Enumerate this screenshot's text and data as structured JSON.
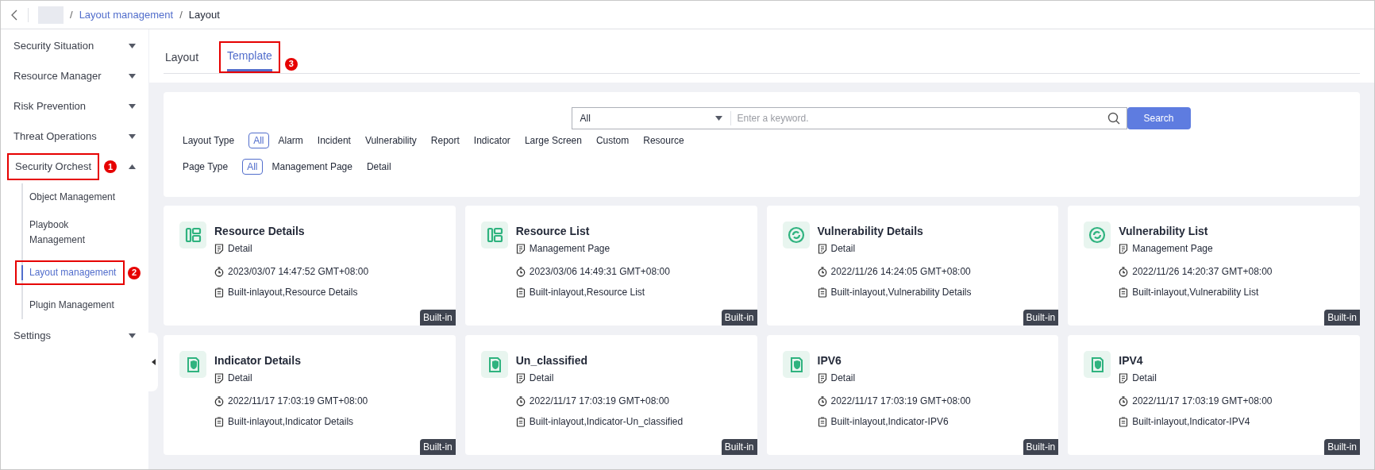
{
  "breadcrumb": {
    "separator": "/",
    "items": [
      {
        "label": "Layout management",
        "link": true
      },
      {
        "label": "Layout",
        "link": false
      }
    ]
  },
  "sidebar": {
    "items": [
      {
        "label": "Security Situation",
        "expanded": false
      },
      {
        "label": "Resource Manager",
        "expanded": false
      },
      {
        "label": "Risk Prevention",
        "expanded": false
      },
      {
        "label": "Threat Operations",
        "expanded": false
      },
      {
        "label": "Security Orchest",
        "expanded": true,
        "callout": "1",
        "children": [
          {
            "label": "Object Management",
            "selected": false
          },
          {
            "label": "Playbook Management",
            "selected": false
          },
          {
            "label": "Layout management",
            "selected": true,
            "callout": "2"
          },
          {
            "label": "Plugin Management",
            "selected": false
          }
        ]
      },
      {
        "label": "Settings",
        "expanded": false
      }
    ]
  },
  "tabs": [
    {
      "label": "Layout",
      "selected": false
    },
    {
      "label": "Template",
      "selected": true,
      "callout": "3"
    }
  ],
  "search": {
    "scope": "All",
    "placeholder": "Enter a keyword.",
    "button": "Search"
  },
  "filters": [
    {
      "label": "Layout Type",
      "options": [
        {
          "label": "All",
          "selected": true
        },
        {
          "label": "Alarm",
          "selected": false
        },
        {
          "label": "Incident",
          "selected": false
        },
        {
          "label": "Vulnerability",
          "selected": false
        },
        {
          "label": "Report",
          "selected": false
        },
        {
          "label": "Indicator",
          "selected": false
        },
        {
          "label": "Large Screen",
          "selected": false
        },
        {
          "label": "Custom",
          "selected": false
        },
        {
          "label": "Resource",
          "selected": false
        }
      ]
    },
    {
      "label": "Page Type",
      "options": [
        {
          "label": "All",
          "selected": true
        },
        {
          "label": "Management Page",
          "selected": false
        },
        {
          "label": "Detail",
          "selected": false
        }
      ]
    }
  ],
  "cards": [
    {
      "kind": "layout",
      "title": "Resource Details",
      "page_type": "Detail",
      "time": "2023/03/07 14:47:52 GMT+08:00",
      "description": "Built-inlayout,Resource Details",
      "badge": "Built-in"
    },
    {
      "kind": "layout",
      "title": "Resource List",
      "page_type": "Management Page",
      "time": "2023/03/06 14:49:31 GMT+08:00",
      "description": "Built-inlayout,Resource List",
      "badge": "Built-in"
    },
    {
      "kind": "sync",
      "title": "Vulnerability Details",
      "page_type": "Detail",
      "time": "2022/11/26 14:24:05 GMT+08:00",
      "description": "Built-inlayout,Vulnerability Details",
      "badge": "Built-in"
    },
    {
      "kind": "sync",
      "title": "Vulnerability List",
      "page_type": "Management Page",
      "time": "2022/11/26 14:20:37 GMT+08:00",
      "description": "Built-inlayout,Vulnerability List",
      "badge": "Built-in"
    },
    {
      "kind": "shield",
      "title": "Indicator Details",
      "page_type": "Detail",
      "time": "2022/11/17 17:03:19 GMT+08:00",
      "description": "Built-inlayout,Indicator Details",
      "badge": "Built-in"
    },
    {
      "kind": "shield",
      "title": "Un_classified",
      "page_type": "Detail",
      "time": "2022/11/17 17:03:19 GMT+08:00",
      "description": "Built-inlayout,Indicator-Un_classified",
      "badge": "Built-in"
    },
    {
      "kind": "shield",
      "title": "IPV6",
      "page_type": "Detail",
      "time": "2022/11/17 17:03:19 GMT+08:00",
      "description": "Built-inlayout,Indicator-IPV6",
      "badge": "Built-in"
    },
    {
      "kind": "shield",
      "title": "IPV4",
      "page_type": "Detail",
      "time": "2022/11/17 17:03:19 GMT+08:00",
      "description": "Built-inlayout,Indicator-IPV4",
      "badge": "Built-in"
    }
  ]
}
